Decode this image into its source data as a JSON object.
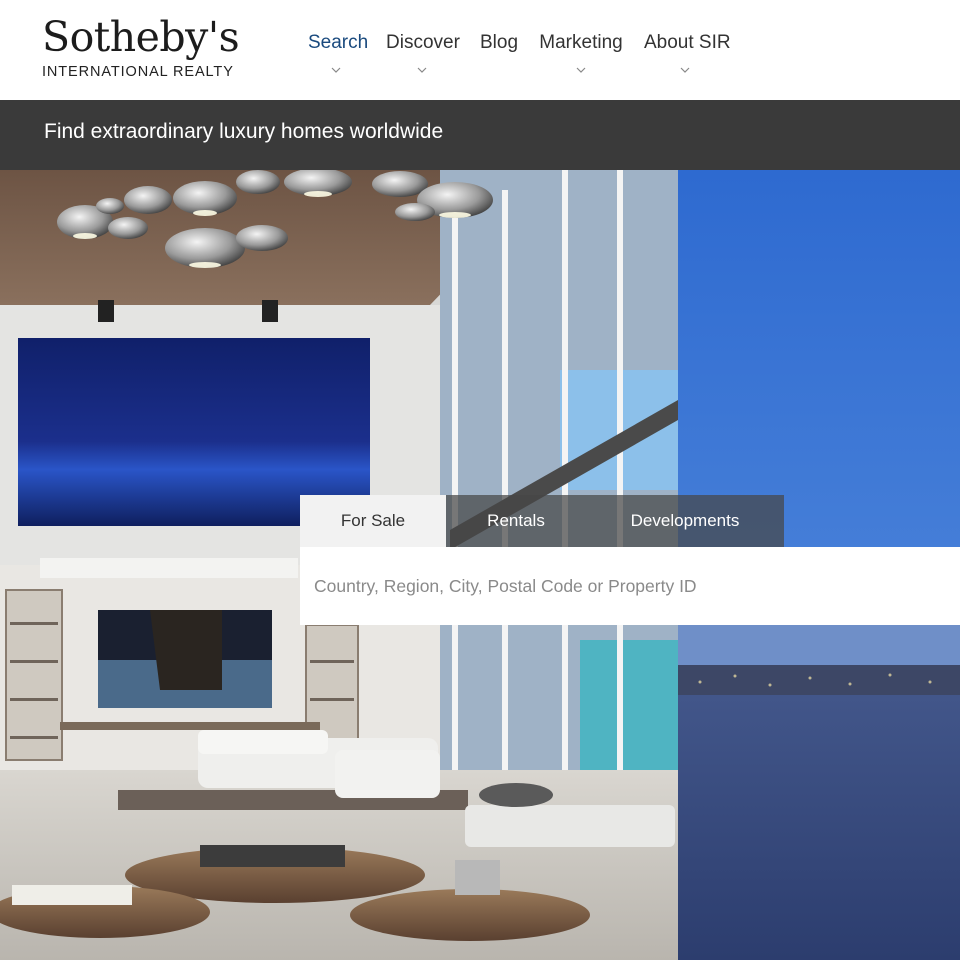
{
  "brand": {
    "name": "Sotheby's",
    "tagline": "INTERNATIONAL REALTY"
  },
  "nav": {
    "items": [
      {
        "label": "Search",
        "active": true
      },
      {
        "label": "Discover"
      },
      {
        "label": "Blog"
      },
      {
        "label": "Marketing"
      },
      {
        "label": "About SIR"
      }
    ]
  },
  "banner": {
    "text": "Find extraordinary luxury homes worldwide"
  },
  "search": {
    "tabs": [
      {
        "label": "For Sale",
        "active": true
      },
      {
        "label": "Rentals"
      },
      {
        "label": "Developments"
      }
    ],
    "placeholder": "Country, Region, City, Postal Code or Property ID",
    "value": ""
  },
  "colors": {
    "nav_active": "#1a4a7e",
    "banner_bg": "#3a3a3a",
    "sky": "#2f6fcc"
  }
}
